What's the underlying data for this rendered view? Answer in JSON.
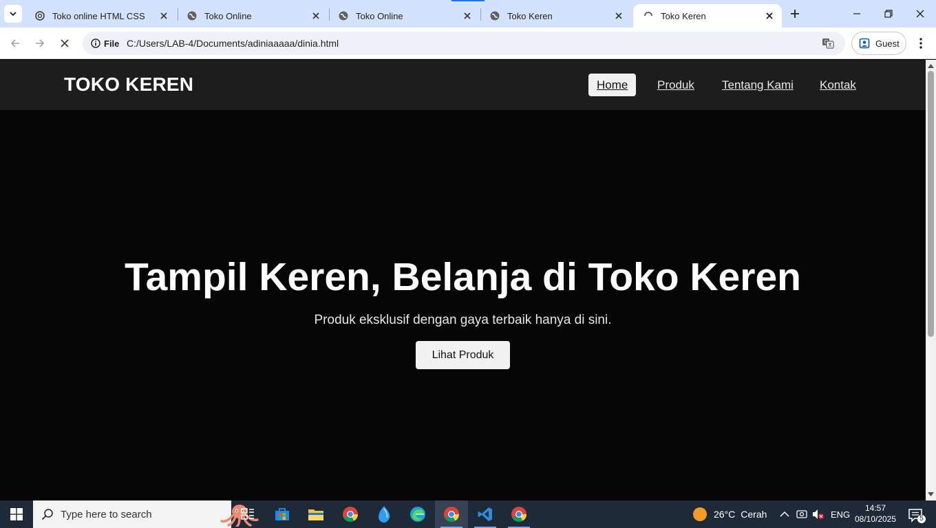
{
  "browser": {
    "tabs": [
      {
        "title": "Toko online HTML CSS"
      },
      {
        "title": "Toko Online"
      },
      {
        "title": "Toko Online"
      },
      {
        "title": "Toko Keren"
      },
      {
        "title": "Toko Keren"
      }
    ],
    "address_chip": "File",
    "url": "C:/Users/LAB-4/Documents/adiniaaaaa/dinia.html",
    "profile_label": "Guest"
  },
  "page": {
    "logo": "TOKO KEREN",
    "nav": [
      "Home",
      "Produk",
      "Tentang Kami",
      "Kontak"
    ],
    "hero_title": "Tampil Keren, Belanja di Toko Keren",
    "hero_subtitle": "Produk eksklusif dengan gaya terbaik hanya di sini.",
    "hero_button": "Lihat Produk"
  },
  "taskbar": {
    "search_placeholder": "Type here to search",
    "weather_temp": "26°C",
    "weather_text": "Cerah",
    "language": "ENG",
    "time": "14:57",
    "date": "08/10/2025",
    "notification_count": "5"
  },
  "colors": {
    "tabstrip": "#d3e3fd",
    "page_bg": "#060606",
    "navbar_bg": "#1d1d1d",
    "taskbar_bg": "#1f2a38"
  }
}
